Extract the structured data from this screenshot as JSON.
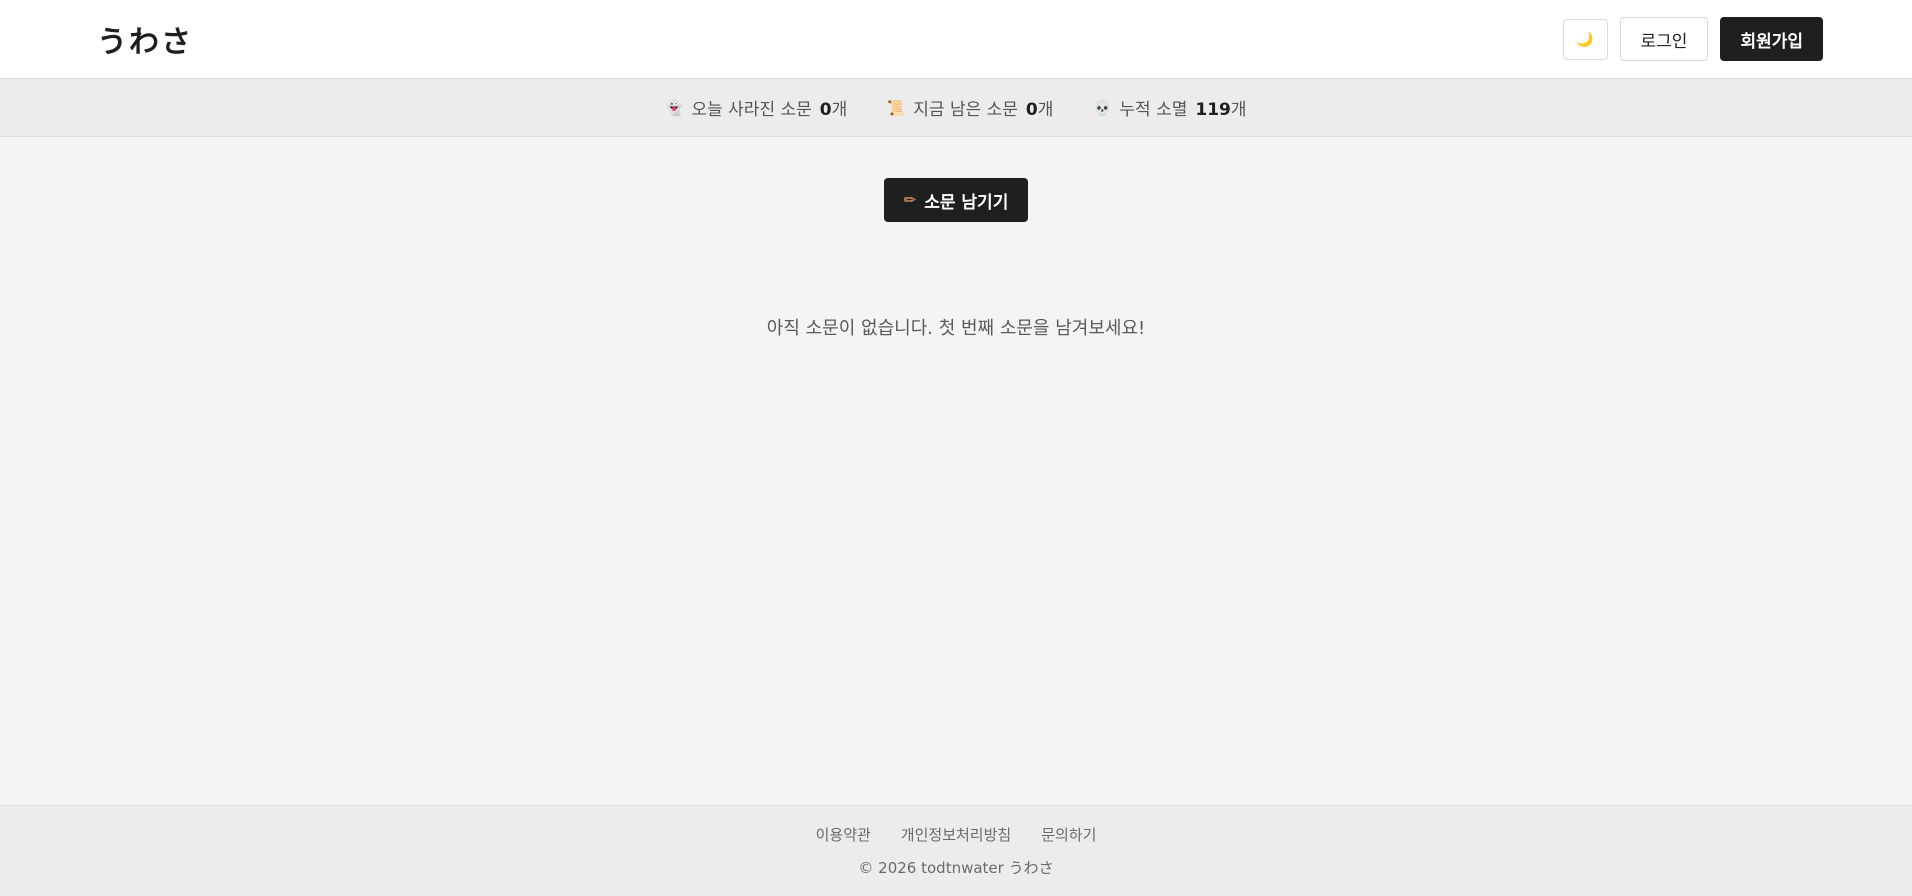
{
  "header": {
    "logo": "うわさ",
    "theme_icon": "🌙",
    "login_label": "로그인",
    "signup_label": "회원가입"
  },
  "stats": [
    {
      "icon": "👻",
      "label": "오늘 사라진 소문",
      "value": "0",
      "unit": "개"
    },
    {
      "icon": "📜",
      "label": "지금 남은 소문",
      "value": "0",
      "unit": "개"
    },
    {
      "icon": "💀",
      "label": "누적 소멸",
      "value": "119",
      "unit": "개"
    }
  ],
  "main": {
    "write_icon": "✏",
    "write_label": "소문 남기기",
    "empty_message": "아직 소문이 없습니다. 첫 번째 소문을 남겨보세요!"
  },
  "footer": {
    "links": [
      "이용약관",
      "개인정보처리방침",
      "문의하기"
    ],
    "copyright": "© 2026 todtnwater うわさ"
  },
  "colors": {
    "primary_dark": "#1f1f1f",
    "background": "#f4f4f4",
    "bar_background": "#ececec"
  }
}
